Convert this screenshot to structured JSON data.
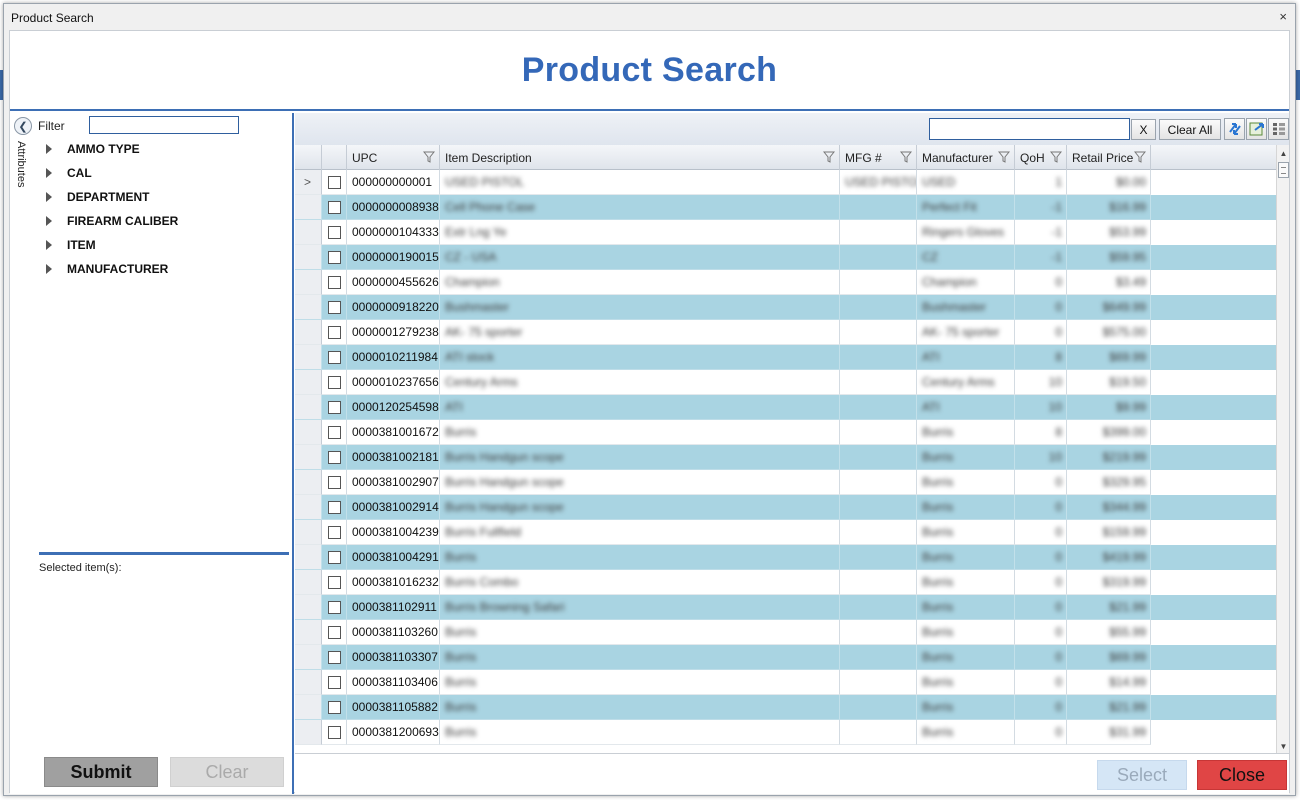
{
  "window": {
    "title": "Product Search",
    "close_glyph": "×"
  },
  "header": {
    "title": "Product Search"
  },
  "sidebar": {
    "tab_label": "Attributes",
    "filter_label": "Filter",
    "filter_value": "",
    "tree": [
      {
        "label": "AMMO TYPE"
      },
      {
        "label": "CAL"
      },
      {
        "label": "DEPARTMENT"
      },
      {
        "label": "FIREARM CALIBER"
      },
      {
        "label": "ITEM"
      },
      {
        "label": "MANUFACTURER"
      }
    ],
    "selected_label": "Selected item(s):",
    "submit_label": "Submit",
    "clear_label": "Clear"
  },
  "toolbar": {
    "search_value": "",
    "x_label": "X",
    "clear_all_label": "Clear All",
    "icons": [
      "refresh-icon",
      "export-icon",
      "column-chooser-icon"
    ]
  },
  "grid": {
    "columns": [
      "UPC",
      "Item Description",
      "MFG #",
      "Manufacturer",
      "QoH",
      "Retail Price"
    ],
    "current_row_glyph": ">",
    "rows": [
      {
        "upc": "000000000001",
        "desc": "USED PISTOL",
        "mfg": "USED PISTOL",
        "man": "USED",
        "qoh": "1",
        "price": "$0.00"
      },
      {
        "upc": "0000000008938",
        "desc": "Cell Phone Case",
        "mfg": "",
        "man": "Perfect Fit",
        "qoh": "-1",
        "price": "$16.99"
      },
      {
        "upc": "0000000104333",
        "desc": "Extr Lng Ye",
        "mfg": "",
        "man": "Ringers Gloves",
        "qoh": "-1",
        "price": "$53.99"
      },
      {
        "upc": "0000000190015",
        "desc": "CZ - USA",
        "mfg": "",
        "man": "CZ",
        "qoh": "-1",
        "price": "$59.95"
      },
      {
        "upc": "0000000455626",
        "desc": "Champion",
        "mfg": "",
        "man": "Champion",
        "qoh": "0",
        "price": "$3.49"
      },
      {
        "upc": "0000000918220",
        "desc": "Bushmaster",
        "mfg": "",
        "man": "Bushmaster",
        "qoh": "0",
        "price": "$649.99"
      },
      {
        "upc": "0000001279238",
        "desc": "AK- 75 sporter",
        "mfg": "",
        "man": "AK- 75 sporter",
        "qoh": "0",
        "price": "$575.00"
      },
      {
        "upc": "0000010211984",
        "desc": "ATI stock",
        "mfg": "",
        "man": "ATI",
        "qoh": "8",
        "price": "$69.99"
      },
      {
        "upc": "0000010237656",
        "desc": "Century Arms",
        "mfg": "",
        "man": "Century Arms",
        "qoh": "10",
        "price": "$19.50"
      },
      {
        "upc": "0000120254598",
        "desc": "ATI",
        "mfg": "",
        "man": "ATI",
        "qoh": "10",
        "price": "$9.99"
      },
      {
        "upc": "0000381001672",
        "desc": "Burris",
        "mfg": "",
        "man": "Burris",
        "qoh": "8",
        "price": "$399.00"
      },
      {
        "upc": "0000381002181",
        "desc": "Burris Handgun scope",
        "mfg": "",
        "man": "Burris",
        "qoh": "10",
        "price": "$219.99"
      },
      {
        "upc": "0000381002907",
        "desc": "Burris Handgun scope",
        "mfg": "",
        "man": "Burris",
        "qoh": "0",
        "price": "$329.95"
      },
      {
        "upc": "0000381002914",
        "desc": "Burris Handgun scope",
        "mfg": "",
        "man": "Burris",
        "qoh": "0",
        "price": "$344.99"
      },
      {
        "upc": "0000381004239",
        "desc": "Burris Fullfield",
        "mfg": "",
        "man": "Burris",
        "qoh": "0",
        "price": "$159.99"
      },
      {
        "upc": "0000381004291",
        "desc": "Burris",
        "mfg": "",
        "man": "Burris",
        "qoh": "0",
        "price": "$419.99"
      },
      {
        "upc": "0000381016232",
        "desc": "Burris Combo",
        "mfg": "",
        "man": "Burris",
        "qoh": "0",
        "price": "$319.99"
      },
      {
        "upc": "0000381102911",
        "desc": "Burris Browning Safari",
        "mfg": "",
        "man": "Burris",
        "qoh": "0",
        "price": "$21.99"
      },
      {
        "upc": "0000381103260",
        "desc": "Burris",
        "mfg": "",
        "man": "Burris",
        "qoh": "0",
        "price": "$55.99"
      },
      {
        "upc": "0000381103307",
        "desc": "Burris",
        "mfg": "",
        "man": "Burris",
        "qoh": "0",
        "price": "$69.99"
      },
      {
        "upc": "0000381103406",
        "desc": "Burris",
        "mfg": "",
        "man": "Burris",
        "qoh": "0",
        "price": "$14.99"
      },
      {
        "upc": "0000381105882",
        "desc": "Burris",
        "mfg": "",
        "man": "Burris",
        "qoh": "0",
        "price": "$21.99"
      },
      {
        "upc": "0000381200693",
        "desc": "Burris",
        "mfg": "",
        "man": "Burris",
        "qoh": "0",
        "price": "$31.99"
      }
    ]
  },
  "footer": {
    "select_label": "Select",
    "close_label": "Close"
  },
  "colors": {
    "accent": "#3468b8",
    "row_alt": "#a9d4e2",
    "close": "#e04545",
    "select": "#d5e6f6",
    "submit": "#a0a0a0"
  }
}
